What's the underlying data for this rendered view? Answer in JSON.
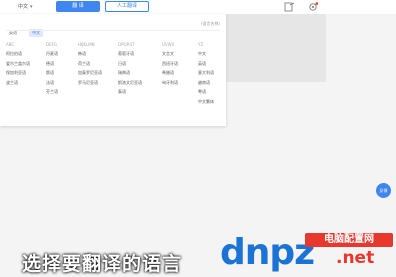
{
  "toolbar": {
    "language_select": "中文",
    "translate_button": "翻 译",
    "human_translate_button": "人工翻译"
  },
  "panel": {
    "tabs": [
      "英语",
      "中文"
    ],
    "right_note": "(语言名称)",
    "columns": [
      {
        "head": "ABC",
        "items": [
          "阿拉伯语",
          "爱尔兰盖尔语",
          "保加利亚语",
          "波兰语"
        ]
      },
      {
        "head": "DEFG",
        "items": [
          "丹麦语",
          "德语",
          "俄语",
          "法语",
          "芬兰语"
        ]
      },
      {
        "head": "HIJKLMN",
        "items": [
          "韩语",
          "荷兰语",
          "加泰罗尼亚语",
          "罗马尼亚语"
        ]
      },
      {
        "head": "OPQRST",
        "items": [
          "葡萄牙语",
          "日语",
          "瑞典语",
          "斯洛文尼亚语",
          "泰语"
        ]
      },
      {
        "head": "UVWX",
        "items": [
          "文言文",
          "西班牙语",
          "希腊语",
          "匈牙利语"
        ]
      },
      {
        "head": "YZ",
        "items": [
          "中文",
          "英语",
          "意大利语",
          "越南语",
          "粤语",
          "中文繁体"
        ]
      }
    ]
  },
  "float_button": "反馈",
  "subtitle": "选择要翻译的语言",
  "watermark": {
    "main": "dnpz",
    "tag": "电脑配置网",
    "suffix": ".net"
  },
  "colors": {
    "accent": "#3f86f0",
    "logo_blue": "#1c73d6",
    "logo_red": "#e8372d"
  }
}
